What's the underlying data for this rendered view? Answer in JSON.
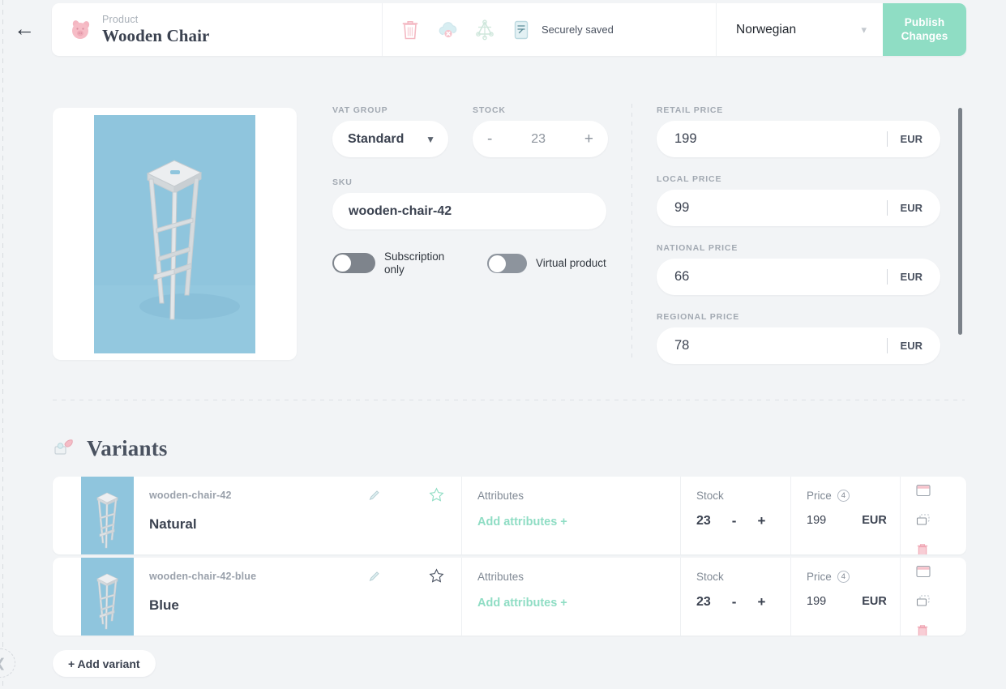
{
  "topbar": {
    "back_icon": "arrow-left-icon",
    "product_icon": "pig-icon",
    "kicker": "Product",
    "title": "Wooden Chair",
    "actions": [
      {
        "icon": "trash-icon",
        "name": "delete-product"
      },
      {
        "icon": "cloud-offline-icon",
        "name": "unpublish"
      },
      {
        "icon": "graphql-icon",
        "name": "api-explorer"
      },
      {
        "icon": "document-icon",
        "name": "document"
      }
    ],
    "saved_status": "Securely saved",
    "language": "Norwegian",
    "language_chevron": "chevron-down-icon",
    "publish_label": "Publish Changes",
    "publish_color": "#8fddc4"
  },
  "product_image": {
    "alt": "Wooden Chair photo",
    "bg_color": "#8dc4dd"
  },
  "fields": {
    "vat_group": {
      "label": "VAT GROUP",
      "value": "Standard",
      "caret": "caret-down-icon"
    },
    "stock": {
      "label": "STOCK",
      "value": "23",
      "minus": "-",
      "plus": "+"
    },
    "sku": {
      "label": "SKU",
      "value": "wooden-chair-42"
    },
    "toggles": [
      {
        "label": "Subscription only",
        "on": false
      },
      {
        "label": "Virtual product",
        "on": false
      }
    ]
  },
  "prices": [
    {
      "label": "RETAIL PRICE",
      "value": "199",
      "currency": "EUR"
    },
    {
      "label": "LOCAL PRICE",
      "value": "99",
      "currency": "EUR"
    },
    {
      "label": "NATIONAL PRICE",
      "value": "66",
      "currency": "EUR"
    },
    {
      "label": "REGIONAL PRICE",
      "value": "78",
      "currency": "EUR"
    }
  ],
  "variants_section": {
    "icon": "variants-icon",
    "title": "Variants",
    "add_label": "+ Add variant",
    "columns": {
      "attributes": "Attributes",
      "stock": "Stock",
      "price": "Price",
      "price_badge": "4"
    },
    "rows": [
      {
        "sku": "wooden-chair-42",
        "name": "Natural",
        "edit_icon": "pencil-icon",
        "star_icon": "star-icon",
        "star_active": true,
        "add_attributes": "Add attributes +",
        "stock": "23",
        "minus": "-",
        "plus": "+",
        "price": "199",
        "currency": "EUR",
        "actions": [
          "image-icon",
          "duplicate-icon",
          "trash-icon"
        ]
      },
      {
        "sku": "wooden-chair-42-blue",
        "name": "Blue",
        "edit_icon": "pencil-icon",
        "star_icon": "star-icon",
        "star_active": false,
        "add_attributes": "Add attributes +",
        "stock": "23",
        "minus": "-",
        "plus": "+",
        "price": "199",
        "currency": "EUR",
        "actions": [
          "image-icon",
          "duplicate-icon",
          "trash-icon"
        ]
      }
    ]
  },
  "sidebar": {
    "collapse_icon": "chevron-left-icon"
  }
}
